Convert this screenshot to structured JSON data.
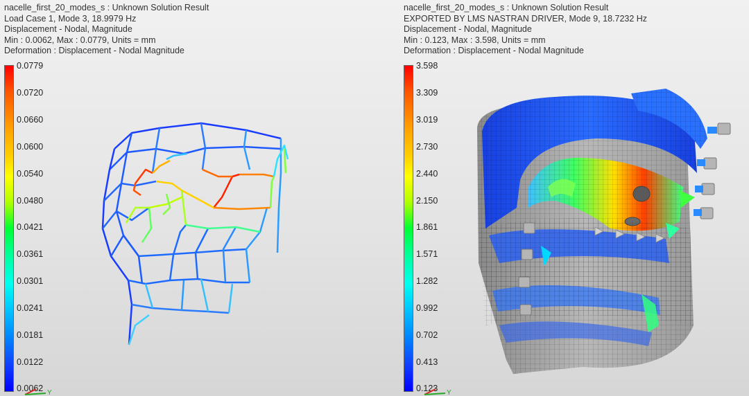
{
  "left": {
    "header": [
      "nacelle_first_20_modes_s : Unknown Solution Result",
      "Load Case 1, Mode 3, 18.9979 Hz",
      "Displacement - Nodal, Magnitude",
      "Min : 0.0062, Max : 0.0779, Units = mm",
      "Deformation : Displacement - Nodal Magnitude"
    ],
    "legend": [
      "0.0779",
      "0.0720",
      "0.0660",
      "0.0600",
      "0.0540",
      "0.0480",
      "0.0421",
      "0.0361",
      "0.0301",
      "0.0241",
      "0.0181",
      "0.0122",
      "0.0062"
    ]
  },
  "right": {
    "header": [
      "nacelle_first_20_modes_s : Unknown Solution Result",
      "EXPORTED BY LMS NASTRAN DRIVER, Mode 9, 18.7232 Hz",
      "Displacement - Nodal, Magnitude",
      "Min : 0.123, Max : 3.598, Units = mm",
      "Deformation : Displacement - Nodal Magnitude"
    ],
    "legend": [
      "3.598",
      "3.309",
      "3.019",
      "2.730",
      "2.440",
      "2.150",
      "1.861",
      "1.571",
      "1.282",
      "0.992",
      "0.702",
      "0.413",
      "0.123"
    ]
  },
  "triad": {
    "y_label": "Y"
  }
}
